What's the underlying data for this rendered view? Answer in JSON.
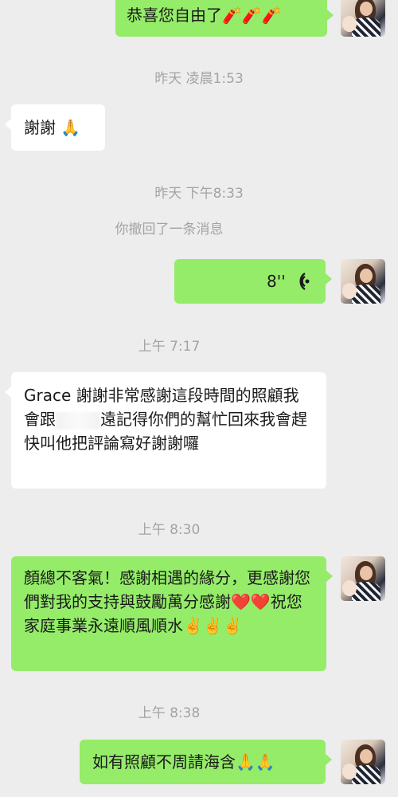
{
  "messages": {
    "m1_text": "恭喜您自由了🧨🧨🧨",
    "ts1": "昨天 凌晨1:53",
    "m2_text": "謝謝 🙏",
    "ts2": "昨天 下午8:33",
    "recall_notice": "你撤回了一条消息",
    "voice_duration": "8''",
    "voice_icon": "voice-wave-icon",
    "ts3": "上午 7:17",
    "m4_before": "Grace 謝謝非常感謝這段時間的照顧我會跟",
    "m4_after": "遠記得你們的幫忙回來我會趕快叫他把評論寫好謝謝囉",
    "ts4": "上午 8:30",
    "m5_text": "顏總不客氣！感謝相遇的緣分，更感謝您們對我的支持與鼓勵萬分感謝❤️❤️祝您家庭事業永遠順風順水✌️✌️✌️",
    "ts5": "上午 8:38",
    "m6_text": "如有照顧不周請海含🙏🙏"
  },
  "colors": {
    "background": "#ededed",
    "outgoing_bubble": "#95ec69",
    "incoming_bubble": "#ffffff",
    "timestamp": "#a3a3a3"
  }
}
